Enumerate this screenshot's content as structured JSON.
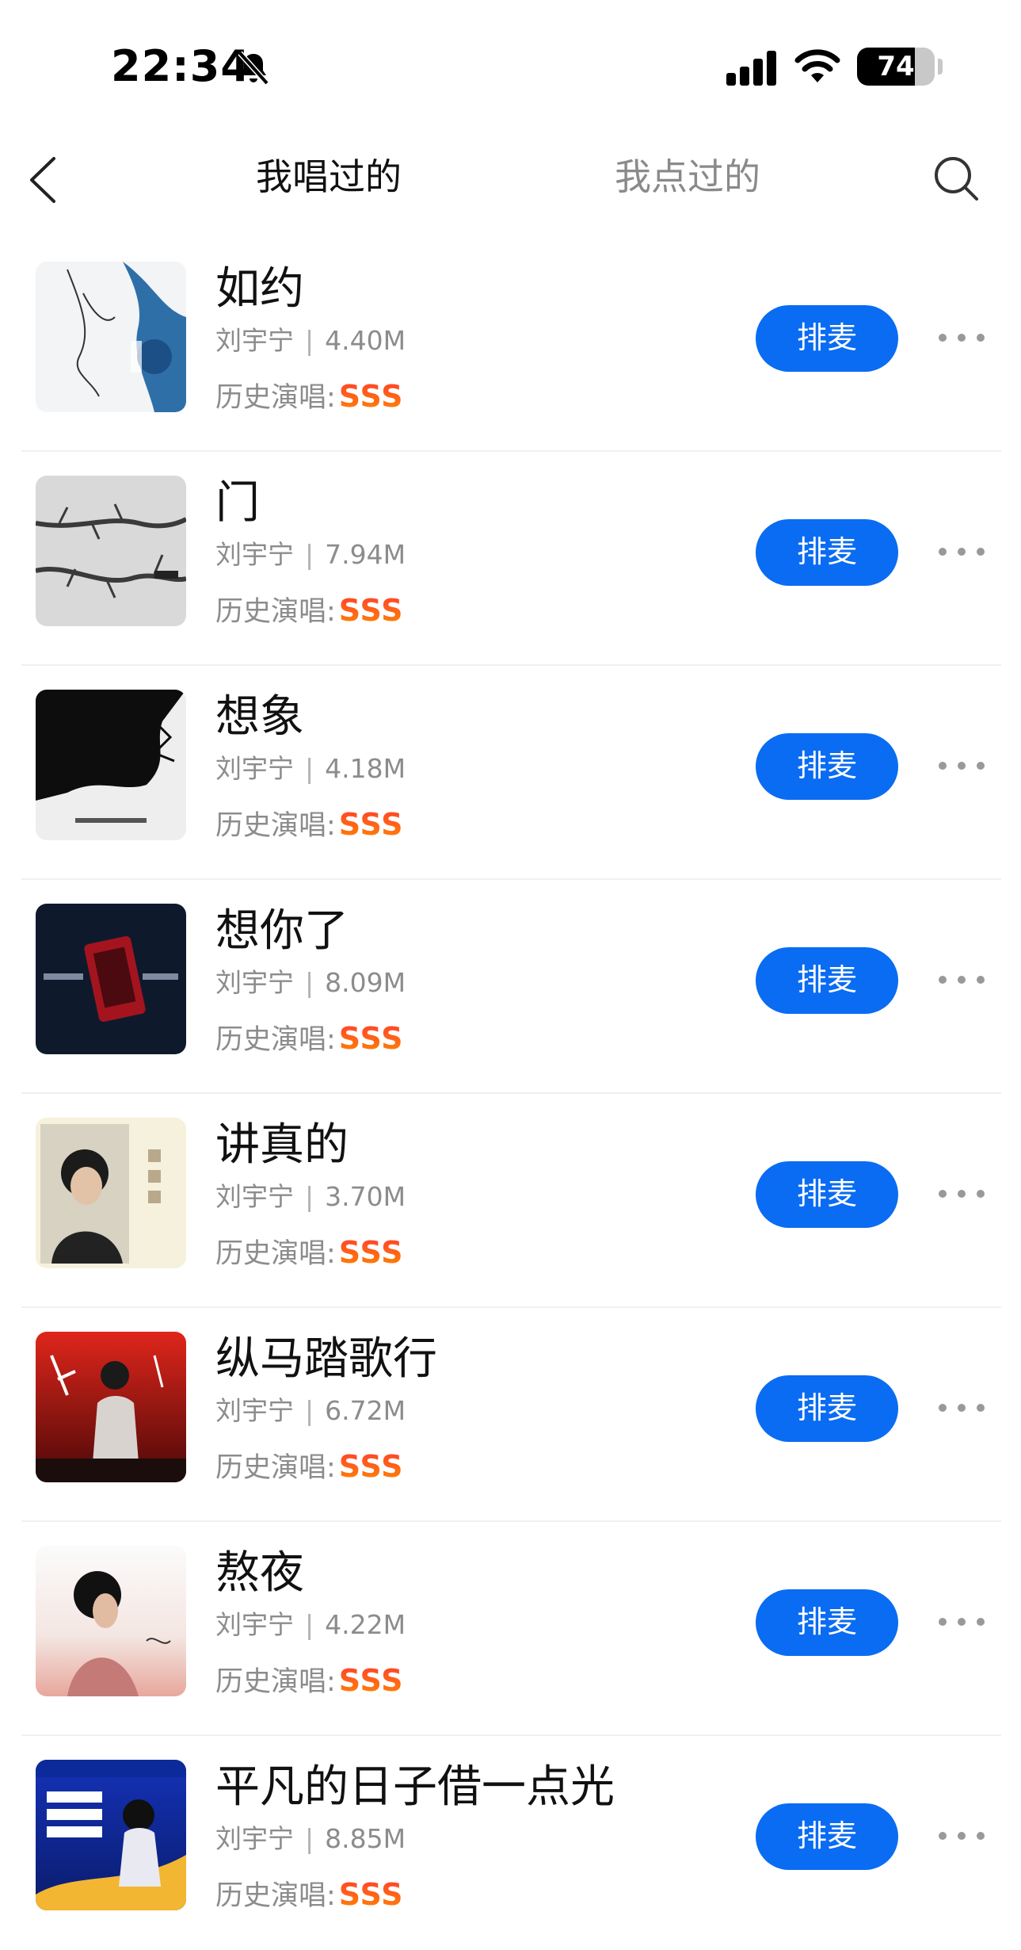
{
  "status_bar": {
    "time": "22:34",
    "battery_level": "74",
    "battery_fraction": 0.74
  },
  "nav": {
    "tabs": [
      {
        "label": "我唱过的",
        "active": true
      },
      {
        "label": "我点过的",
        "active": false
      }
    ]
  },
  "colors": {
    "accent": "#0a6cf2",
    "grade": "#ff4a2a"
  },
  "songs": [
    {
      "title": "如约",
      "artist": "刘宇宁",
      "size": "4.40M",
      "history_label": "历史演唱:",
      "grade": "SSS",
      "action": "排麦"
    },
    {
      "title": "门",
      "artist": "刘宇宁",
      "size": "7.94M",
      "history_label": "历史演唱:",
      "grade": "SSS",
      "action": "排麦"
    },
    {
      "title": "想象",
      "artist": "刘宇宁",
      "size": "4.18M",
      "history_label": "历史演唱:",
      "grade": "SSS",
      "action": "排麦"
    },
    {
      "title": "想你了",
      "artist": "刘宇宁",
      "size": "8.09M",
      "history_label": "历史演唱:",
      "grade": "SSS",
      "action": "排麦"
    },
    {
      "title": "讲真的",
      "artist": "刘宇宁",
      "size": "3.70M",
      "history_label": "历史演唱:",
      "grade": "SSS",
      "action": "排麦"
    },
    {
      "title": "纵马踏歌行",
      "artist": "刘宇宁",
      "size": "6.72M",
      "history_label": "历史演唱:",
      "grade": "SSS",
      "action": "排麦"
    },
    {
      "title": "熬夜",
      "artist": "刘宇宁",
      "size": "4.22M",
      "history_label": "历史演唱:",
      "grade": "SSS",
      "action": "排麦"
    },
    {
      "title": "平凡的日子借一点光",
      "artist": "刘宇宁",
      "size": "8.85M",
      "history_label": "历史演唱:",
      "grade": "SSS",
      "action": "排麦"
    }
  ]
}
